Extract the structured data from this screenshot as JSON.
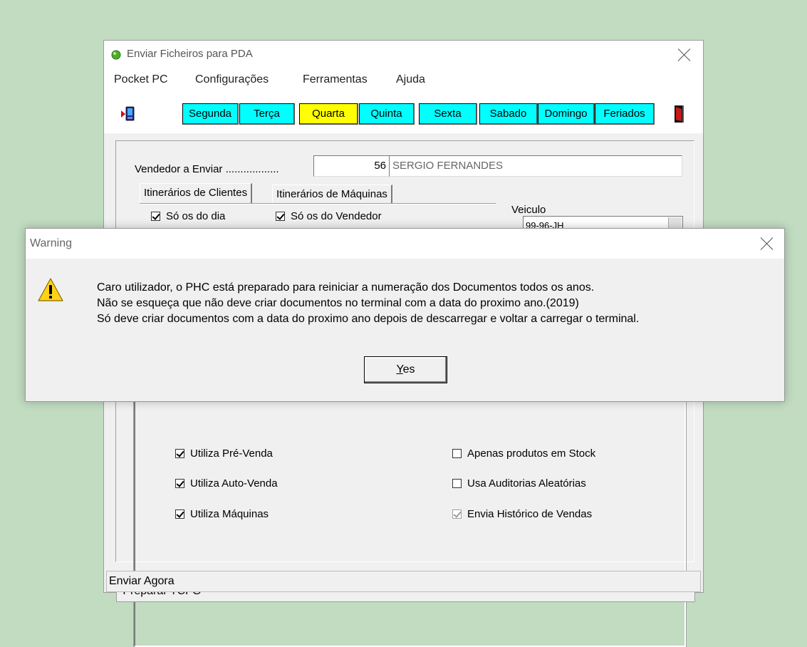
{
  "main_window": {
    "title": "Enviar Ficheiros para PDA",
    "menu": [
      "Pocket PC",
      "Configurações",
      "Ferramentas",
      "Ajuda"
    ],
    "days": [
      "Segunda",
      "Terça",
      "Quarta",
      "Quinta",
      "Sexta",
      "Sabado",
      "Domingo",
      "Feriados"
    ],
    "selected_day": "Quarta",
    "vendedor_label": "Vendedor a Enviar ..................",
    "vendedor_number": "56",
    "vendedor_name": "SERGIO FERNANDES",
    "tabs": [
      "Itinerários de Clientes",
      "Itinerários de Máquinas"
    ],
    "so_os_do_dia": "Só os do dia",
    "so_os_do_vendedor": "Só os do Vendedor",
    "veiculo_label": "Veiculo",
    "veiculo_value": "99-96-JH",
    "options_left": [
      {
        "label": "Utiliza Pré-Venda",
        "checked": true
      },
      {
        "label": "Utiliza Auto-Venda",
        "checked": true
      },
      {
        "label": "Utiliza Máquinas",
        "checked": true
      }
    ],
    "options_right": [
      {
        "label": "Apenas produtos em Stock",
        "checked": false
      },
      {
        "label": "Usa Auditorias Aleatórias",
        "checked": false
      },
      {
        "label": "Envia Histórico de Vendas",
        "checked": true,
        "disabled": true
      }
    ],
    "status_preparar": "-Preparar TCFG",
    "status_enviar": "Enviar Agora"
  },
  "dialog": {
    "title": "Warning",
    "lines": [
      "Caro utilizador, o PHC está preparado para reiniciar a numeração dos Documentos todos os anos.",
      "Não se esqueça que não deve criar documentos no terminal com a data do proximo ano.(2019)",
      "Só deve criar documentos com a data do proximo ano depois de descarregar e voltar a carregar o terminal."
    ],
    "yes_accel": "Y",
    "yes_rest": "es"
  },
  "colors": {
    "desktop": "#c1dcc1",
    "day_button": "#00ffff",
    "day_selected": "#ffff00"
  }
}
